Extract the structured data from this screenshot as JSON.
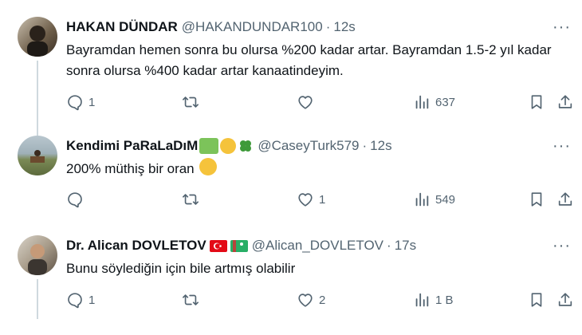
{
  "tweets": [
    {
      "name": "HAKAN DÜNDAR",
      "handle": "@HAKANDUNDAR100",
      "time": "12s",
      "text": "Bayramdan hemen sonra bu olursa %200 kadar artar. Bayramdan 1.5-2 yıl kadar sonra olursa %400 kadar artar kanaatindeyim.",
      "replies": "1",
      "retweets": "",
      "likes": "",
      "views": "637"
    },
    {
      "name": "Kendimi PaRaLaDıM",
      "handle": "@CaseyTurk579",
      "time": "12s",
      "text": "200% müthiş bir oran",
      "replies": "",
      "retweets": "",
      "likes": "1",
      "views": "549"
    },
    {
      "name": "Dr. Alican DOVLETOV",
      "handle": "@Alican_DOVLETOV",
      "time": "17s",
      "text": "Bunu söylediğin için bile artmış olabilir",
      "replies": "1",
      "retweets": "",
      "likes": "2",
      "views": "1 B"
    }
  ],
  "separator": "·",
  "more_label": "···",
  "icons": {
    "reply": "reply-icon",
    "retweet": "retweet-icon",
    "like": "heart-icon",
    "views": "views-icon",
    "bookmark": "bookmark-icon",
    "share": "share-icon"
  },
  "colors": {
    "name": "#0f1419",
    "secondary": "#536471",
    "thread_line": "#cfd9de"
  }
}
